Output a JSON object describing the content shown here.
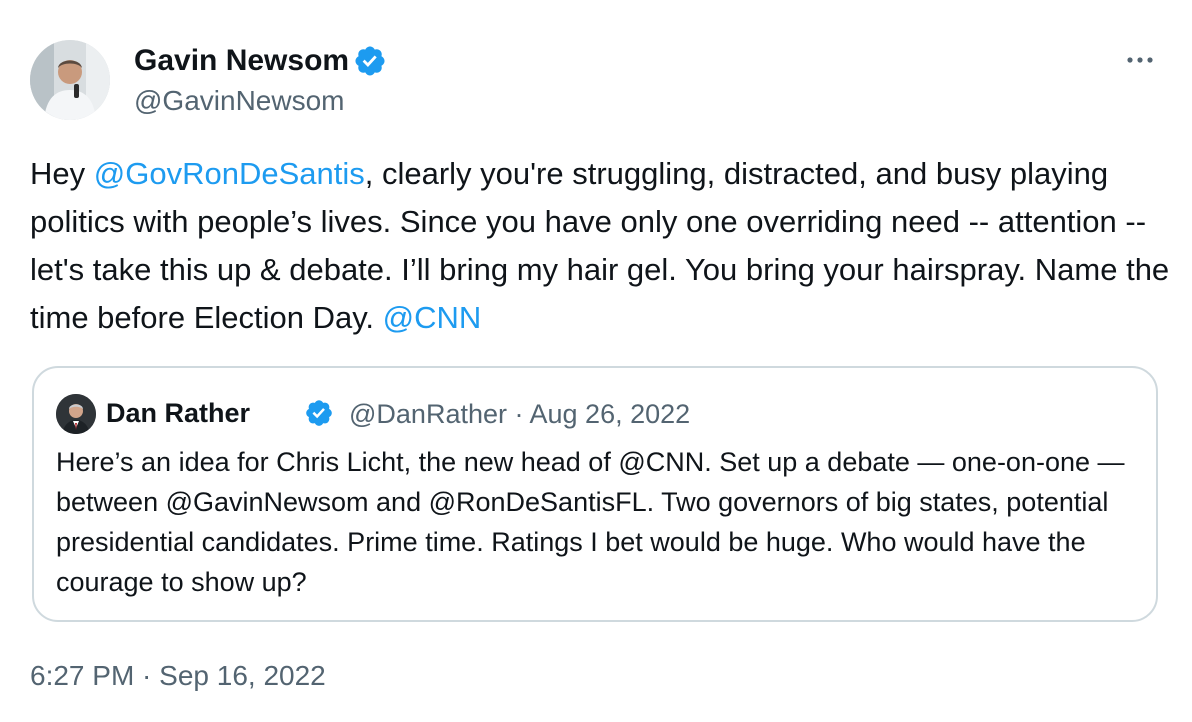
{
  "author": {
    "name": "Gavin Newsom",
    "handle": "@GavinNewsom",
    "verified_icon": "verified-badge-icon",
    "avatar_icon": "user-avatar"
  },
  "menu": {
    "icon": "more-horizontal-icon"
  },
  "tweet": {
    "segments": {
      "s0": "Hey ",
      "m0": "@GovRonDeSantis",
      "s1": ", clearly you're struggling, distracted, and busy playing politics with people’s lives. Since you have only one overriding need -- attention --let's take this up & debate. I’ll bring my hair gel. You bring your hairspray. Name the time before Election Day. ",
      "m1": "@CNN"
    }
  },
  "quote": {
    "name": "Dan Rather",
    "handle": "@DanRather",
    "separator": "·",
    "date": "Aug 26, 2022",
    "text": "Here’s an idea for Chris Licht, the new head of @CNN. Set up a debate — one-on-one — between @GavinNewsom and @RonDeSantisFL. Two governors of big states, potential presidential candidates. Prime time. Ratings I bet would be huge. Who would have the courage to show up?"
  },
  "timestamp": "6:27 PM · Sep 16, 2022",
  "colors": {
    "link": "#1d9bf0",
    "verified": "#1d9bf0",
    "secondary_text": "#536471",
    "border": "#cfd9de"
  }
}
